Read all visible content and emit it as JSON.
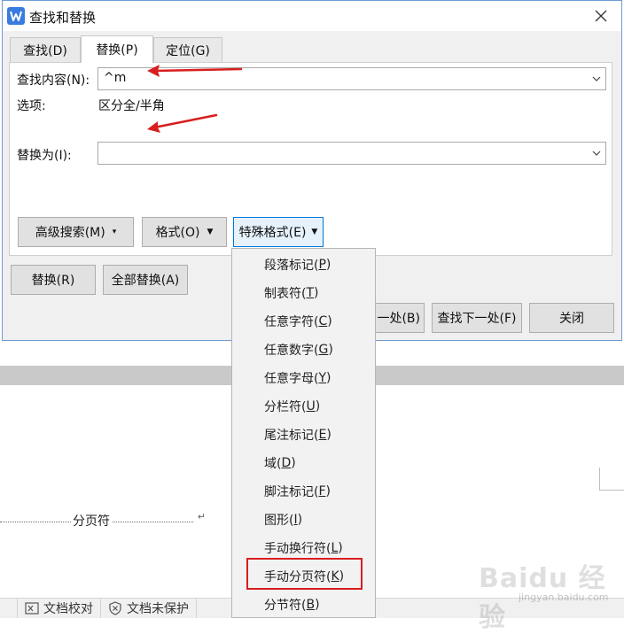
{
  "dialog": {
    "title": "查找和替换",
    "tabs": [
      {
        "label": "查找(D)"
      },
      {
        "label": "替换(P)",
        "active": true
      },
      {
        "label": "定位(G)"
      }
    ],
    "find_label": "查找内容(N):",
    "find_value": "^m",
    "options_label": "选项:",
    "options_value": "区分全/半角",
    "replace_label": "替换为(I):",
    "replace_value": "",
    "buttons": {
      "advanced_search": "高级搜索(M)",
      "format": "格式(O)",
      "special_format": "特殊格式(E)",
      "replace": "替换(R)",
      "replace_all": "全部替换(A)",
      "find_prev": "一处(B)",
      "find_next": "查找下一处(F)",
      "close": "关闭"
    }
  },
  "special_menu": {
    "items": [
      {
        "text": "段落标记(",
        "key": "P",
        "end": ")"
      },
      {
        "text": "制表符(",
        "key": "T",
        "end": ")"
      },
      {
        "text": "任意字符(",
        "key": "C",
        "end": ")"
      },
      {
        "text": "任意数字(",
        "key": "G",
        "end": ")"
      },
      {
        "text": "任意字母(",
        "key": "Y",
        "end": ")"
      },
      {
        "text": "分栏符(",
        "key": "U",
        "end": ")"
      },
      {
        "text": "尾注标记(",
        "key": "E",
        "end": ")"
      },
      {
        "text": "域(",
        "key": "D",
        "end": ")"
      },
      {
        "text": "脚注标记(",
        "key": "F",
        "end": ")"
      },
      {
        "text": "图形(",
        "key": "I",
        "end": ")"
      },
      {
        "text": "手动换行符(",
        "key": "L",
        "end": ")"
      },
      {
        "text": "手动分页符(",
        "key": "K",
        "end": ")"
      },
      {
        "text": "分节符(",
        "key": "B",
        "end": ")"
      }
    ],
    "highlighted": "手动分页符"
  },
  "document": {
    "page_break_label": "分页符",
    "paragraph_mark": "↵"
  },
  "statusbar": {
    "proofread": "文档校对",
    "protect": "文档未保护"
  },
  "watermark": {
    "text": "Baidu 经验",
    "sub": "jingyan.baidu.com"
  },
  "colors": {
    "annotation_red": "#d81e1e",
    "accent_blue": "#0078d7",
    "app_icon_blue": "#3a7be0"
  }
}
